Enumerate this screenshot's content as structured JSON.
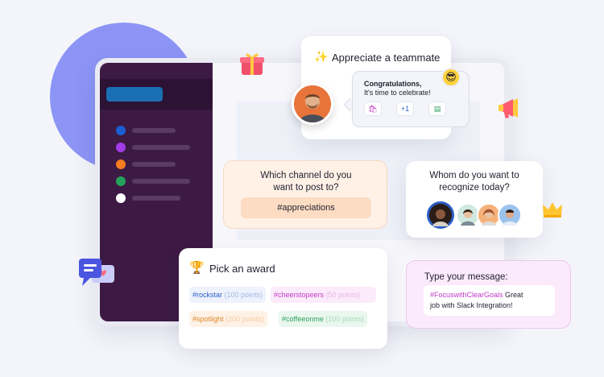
{
  "appreciate": {
    "title": "Appreciate a teammate",
    "bubble_line1": "Congratulations,",
    "bubble_line2": "It's time to celebrate!",
    "reaction_plus": "+1"
  },
  "channel": {
    "question_line1": "Which channel do you",
    "question_line2": "want to post to?",
    "selected": "#appreciations"
  },
  "recognize": {
    "question_line1": "Whom do you want to",
    "question_line2": "recognize today?"
  },
  "award": {
    "title": "Pick an award",
    "options": [
      {
        "tag": "#rockstar",
        "points": "(100 points)",
        "color": "#2b5fc7",
        "bg": "#eef2fc"
      },
      {
        "tag": "#cheerstopeers",
        "points": "(50 points)",
        "color": "#c13cc8",
        "bg": "#fcebfa"
      },
      {
        "tag": "#spotlight",
        "points": "(200 points)",
        "color": "#e0862a",
        "bg": "#fef2e6"
      },
      {
        "tag": "#coffeeonme",
        "points": "(100 points)",
        "color": "#2fa25c",
        "bg": "#e9f7ee"
      }
    ]
  },
  "message": {
    "title": "Type your message:",
    "hashtag": "#FocuswithClearGoals",
    "line1_rest": " Great",
    "line2": "job with Slack Integration!"
  },
  "colors": {
    "sidebar": "#3c1a44",
    "accent_blue": "#1a6fb4",
    "circle": "#8c95f6"
  }
}
